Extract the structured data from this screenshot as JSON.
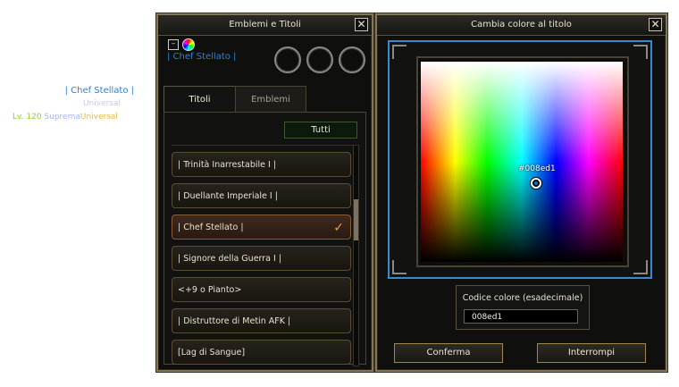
{
  "nameplate": {
    "title": "| Chef Stellato |",
    "guild": "Universal",
    "level": "Lv. 120",
    "rank": "Suprema",
    "empire": "Universal"
  },
  "emblems_window": {
    "title": "Emblemi e Titoli",
    "minimize": "–",
    "selected_title": "| Chef Stellato |",
    "tabs": [
      "Titoli",
      "Emblemi"
    ],
    "filter": "Tutti",
    "titles": [
      {
        "label": "| Trinità Inarrestabile I |",
        "selected": false
      },
      {
        "label": "| Duellante Imperiale I |",
        "selected": false
      },
      {
        "label": "| Chef Stellato |",
        "selected": true
      },
      {
        "label": "| Signore della Guerra I |",
        "selected": false
      },
      {
        "label": "<+9 o Pianto>",
        "selected": false
      },
      {
        "label": "| Distruttore di Metin AFK |",
        "selected": false
      },
      {
        "label": "[Lag di Sangue]",
        "selected": false
      }
    ],
    "check_icon": "✓"
  },
  "picker_window": {
    "title": "Cambia colore al titolo",
    "cursor_label": "#008ed1",
    "hex_label": "Codice colore (esadecimale)",
    "hex_value": "008ed1",
    "confirm": "Conferma",
    "cancel": "Interrompi"
  },
  "colors": {
    "title_blue": "#2f7fd8",
    "frame_gold": "#857656",
    "picker_border": "#3b8ad0"
  }
}
